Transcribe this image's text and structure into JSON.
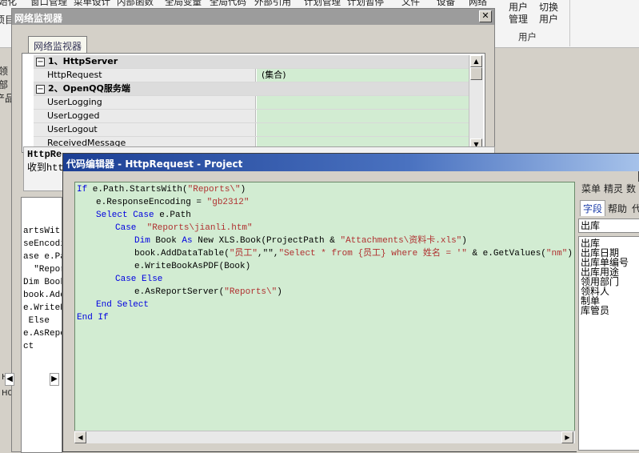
{
  "ribbon": {
    "items": [
      "始化",
      "窗口管理",
      "菜单设计",
      "内部函数",
      "全局变量",
      "全局代码",
      "外部引用",
      "计划管理",
      "计划暂停",
      "文件",
      "设备",
      "网络"
    ],
    "user_buttons": [
      {
        "line1": "用户",
        "line2": "管理"
      },
      {
        "line1": "切换",
        "line2": "用户"
      }
    ],
    "group_label": "用户"
  },
  "underlying": {
    "left_fragments": [
      "项目",
      "领",
      "部",
      "产品",
      "H0",
      "H0"
    ],
    "left_side_char": "组"
  },
  "net_monitor": {
    "title": "网络监视器",
    "close_label": "✕",
    "tab_label": "网络监视器",
    "rows": [
      {
        "kind": "category",
        "toggle": "⊟",
        "label": "1、HttpServer"
      },
      {
        "kind": "property",
        "name": "HttpRequest",
        "value": "(集合)"
      },
      {
        "kind": "category",
        "toggle": "⊟",
        "label": "2、OpenQQ服务端"
      },
      {
        "kind": "property",
        "name": "UserLogging",
        "value": ""
      },
      {
        "kind": "property",
        "name": "UserLogged",
        "value": ""
      },
      {
        "kind": "property",
        "name": "UserLogout",
        "value": ""
      },
      {
        "kind": "property",
        "name": "ReceivedMessage",
        "value": ""
      }
    ],
    "detail_title": "HttpRe",
    "detail_text": "收到htt",
    "code_preview": [
      "artsWit",
      "seEncodi",
      "ase e.Pa",
      "  \"Repor",
      "Dim Book",
      "book.Add",
      "e.WriteB",
      " Else",
      "e.AsRepo",
      "ct"
    ]
  },
  "editor": {
    "title": "代码编辑器 - HttpRequest - Project",
    "code_lines": [
      {
        "indent": 0,
        "parts": [
          {
            "t": "If",
            "c": "kw"
          },
          {
            "t": " e.Path.StartsWith(",
            "c": ""
          },
          {
            "t": "\"Reports\\\"",
            "c": "str"
          },
          {
            "t": ")",
            "c": ""
          }
        ]
      },
      {
        "indent": 1,
        "parts": [
          {
            "t": "e.ResponseEncoding = ",
            "c": ""
          },
          {
            "t": "\"gb2312\"",
            "c": "str"
          }
        ]
      },
      {
        "indent": 1,
        "parts": [
          {
            "t": "Select Case",
            "c": "kw"
          },
          {
            "t": " e.Path",
            "c": ""
          }
        ]
      },
      {
        "indent": 2,
        "parts": [
          {
            "t": "Case",
            "c": "kw"
          },
          {
            "t": "  ",
            "c": ""
          },
          {
            "t": "\"Reports\\jianli.htm\"",
            "c": "str"
          }
        ]
      },
      {
        "indent": 3,
        "parts": [
          {
            "t": "Dim",
            "c": "kw"
          },
          {
            "t": " Book ",
            "c": ""
          },
          {
            "t": "As",
            "c": "kw"
          },
          {
            "t": " New XLS.Book(ProjectPath & ",
            "c": ""
          },
          {
            "t": "\"Attachments\\资料卡.xls\"",
            "c": "str"
          },
          {
            "t": ")",
            "c": ""
          }
        ]
      },
      {
        "indent": 3,
        "parts": [
          {
            "t": "book.AddDataTable(",
            "c": ""
          },
          {
            "t": "\"员工\"",
            "c": "str"
          },
          {
            "t": ",\"\",",
            "c": ""
          },
          {
            "t": "\"Select * from {员工} where 姓名 = '\"",
            "c": "str"
          },
          {
            "t": " & e.GetValues(",
            "c": ""
          },
          {
            "t": "\"nm\"",
            "c": "str"
          },
          {
            "t": ") & \"'\"",
            "c": ""
          }
        ]
      },
      {
        "indent": 3,
        "parts": [
          {
            "t": "e.WriteBookAsPDF(Book)",
            "c": ""
          }
        ]
      },
      {
        "indent": 2,
        "parts": [
          {
            "t": "Case Else",
            "c": "kw"
          }
        ]
      },
      {
        "indent": 3,
        "parts": [
          {
            "t": "e.AsReportServer(",
            "c": ""
          },
          {
            "t": "\"Reports\\\"",
            "c": "str"
          },
          {
            "t": ")",
            "c": ""
          }
        ]
      },
      {
        "indent": 1,
        "parts": [
          {
            "t": "End Select",
            "c": "kw"
          }
        ]
      },
      {
        "indent": 0,
        "parts": [
          {
            "t": "End If",
            "c": "kw"
          }
        ]
      }
    ],
    "side_tabs_top": [
      "菜单",
      "精灵",
      "数"
    ],
    "side_tabs": [
      {
        "label": "字段",
        "active": true
      },
      {
        "label": "帮助",
        "active": false
      },
      {
        "label": "代",
        "active": false
      }
    ],
    "side_combo_value": "出库",
    "side_fields": [
      "出库",
      "出库日期",
      "出库单编号",
      "出库用途",
      "领用部门",
      "领料人",
      "制单",
      "库管员"
    ]
  },
  "colors": {
    "editor_bg": "#d2ecd2",
    "title_blue": "#1c3f94",
    "keyword": "#0000e0",
    "string": "#b03030"
  }
}
